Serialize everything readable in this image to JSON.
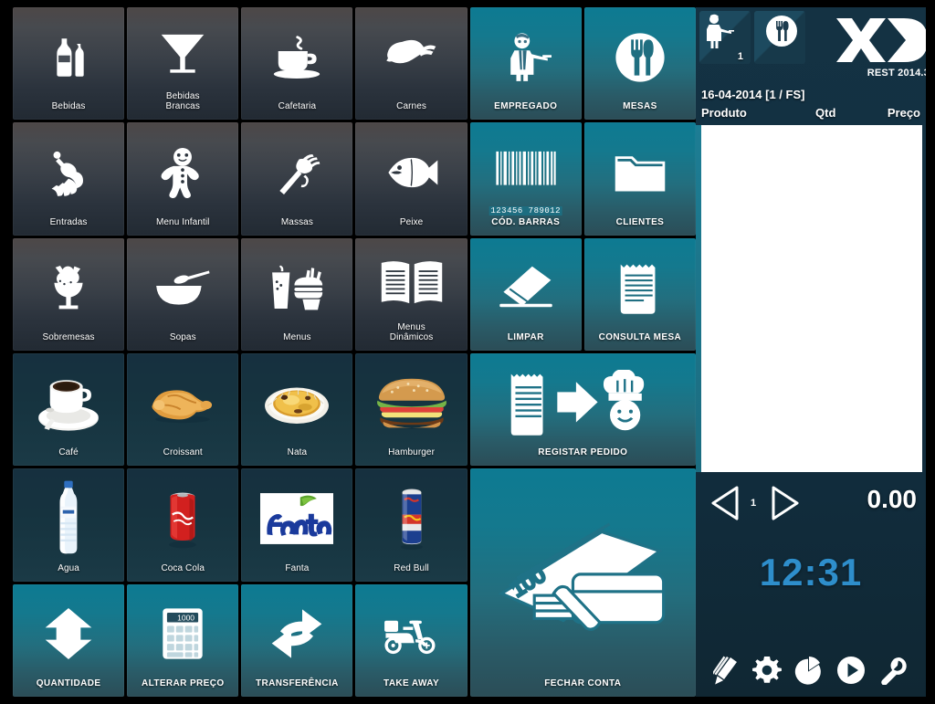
{
  "app": {
    "brand": "XD",
    "version_label": "REST 2014.3",
    "theme": {
      "accent_teal": "#14798e",
      "panel_navy": "#123042",
      "clock_blue": "#2e8ecb",
      "tile_grey": "#3a4048",
      "tile_product": "#17323f"
    }
  },
  "grid": {
    "tiles": [
      {
        "label": "Bebidas",
        "kind": "cat",
        "icon": "bottles-icon"
      },
      {
        "label": "Bebidas\nBrancas",
        "kind": "cat",
        "icon": "cocktail-glass-icon"
      },
      {
        "label": "Cafetaria",
        "kind": "cat",
        "icon": "coffee-cup-icon"
      },
      {
        "label": "Carnes",
        "kind": "cat",
        "icon": "meat-leg-icon"
      },
      {
        "label": "EMPREGADO",
        "kind": "act",
        "icon": "waiter-icon"
      },
      {
        "label": "MESAS",
        "kind": "act",
        "icon": "fork-knife-circle-icon"
      },
      {
        "label": "Entradas",
        "kind": "cat",
        "icon": "shrimp-icon"
      },
      {
        "label": "Menu Infantil",
        "kind": "cat",
        "icon": "gingerbread-man-icon"
      },
      {
        "label": "Massas",
        "kind": "cat",
        "icon": "pasta-fork-icon"
      },
      {
        "label": "Peixe",
        "kind": "cat",
        "icon": "fish-icon"
      },
      {
        "label": "CÓD. BARRAS",
        "kind": "act",
        "icon": "barcode-icon",
        "barcode_digits": "123456 789012"
      },
      {
        "label": "CLIENTES",
        "kind": "act",
        "icon": "folder-icon"
      },
      {
        "label": "Sobremesas",
        "kind": "cat",
        "icon": "ice-cream-sundae-icon"
      },
      {
        "label": "Sopas",
        "kind": "cat",
        "icon": "soup-bowl-icon"
      },
      {
        "label": "Menus",
        "kind": "cat",
        "icon": "combo-meal-icon"
      },
      {
        "label": "Menus\nDinâmicos",
        "kind": "cat",
        "icon": "open-book-icon"
      },
      {
        "label": "LIMPAR",
        "kind": "act",
        "icon": "eraser-icon"
      },
      {
        "label": "CONSULTA MESA",
        "kind": "act",
        "icon": "receipt-icon"
      },
      {
        "label": "Café",
        "kind": "prod",
        "icon": "coffee-photo-icon"
      },
      {
        "label": "Croissant",
        "kind": "prod",
        "icon": "croissant-photo-icon"
      },
      {
        "label": "Nata",
        "kind": "prod",
        "icon": "pastel-de-nata-photo-icon"
      },
      {
        "label": "Hamburger",
        "kind": "prod",
        "icon": "hamburger-photo-icon"
      },
      {
        "label": "REGISTAR PEDIDO",
        "kind": "act",
        "icon": "receipt-to-chef-icon",
        "span": 2
      },
      {
        "label": "Agua",
        "kind": "prod",
        "icon": "water-bottle-photo-icon"
      },
      {
        "label": "Coca Cola",
        "kind": "prod",
        "icon": "coke-can-photo-icon"
      },
      {
        "label": "Fanta",
        "kind": "prod",
        "icon": "fanta-logo-icon"
      },
      {
        "label": "Red Bull",
        "kind": "prod",
        "icon": "redbull-can-photo-icon"
      },
      {
        "label": "FECHAR CONTA",
        "kind": "act",
        "icon": "cash-card-icon",
        "span": 2,
        "rowspan": 2,
        "money_note": "100"
      },
      {
        "label": "QUANTIDADE",
        "kind": "act",
        "icon": "up-down-arrows-icon"
      },
      {
        "label": "ALTERAR PREÇO",
        "kind": "act",
        "icon": "calculator-icon",
        "display": "1000"
      },
      {
        "label": "TRANSFERÊNCIA",
        "kind": "act",
        "icon": "transfer-arrows-icon"
      },
      {
        "label": "TAKE AWAY",
        "kind": "act",
        "icon": "scooter-icon"
      }
    ]
  },
  "right_panel": {
    "tabs": [
      {
        "name": "employee-tab",
        "icon": "waiter-icon",
        "badge": "1"
      },
      {
        "name": "table-tab",
        "icon": "fork-knife-circle-icon",
        "badge": ""
      }
    ],
    "date_line": "16-04-2014 [1 / FS]",
    "columns": {
      "product": "Produto",
      "qty": "Qtd",
      "price": "Preço"
    },
    "order_lines": [],
    "pagination": {
      "page": "1",
      "prev": "prev-page",
      "next": "next-page"
    },
    "total": "0.00",
    "clock": "12:31",
    "toolbar": [
      {
        "name": "pencil-icon",
        "label": "Editar"
      },
      {
        "name": "gear-icon",
        "label": "Configurações"
      },
      {
        "name": "pie-chart-icon",
        "label": "Relatórios"
      },
      {
        "name": "play-icon",
        "label": "Iniciar"
      },
      {
        "name": "wrench-icon",
        "label": "Ferramentas"
      }
    ]
  }
}
